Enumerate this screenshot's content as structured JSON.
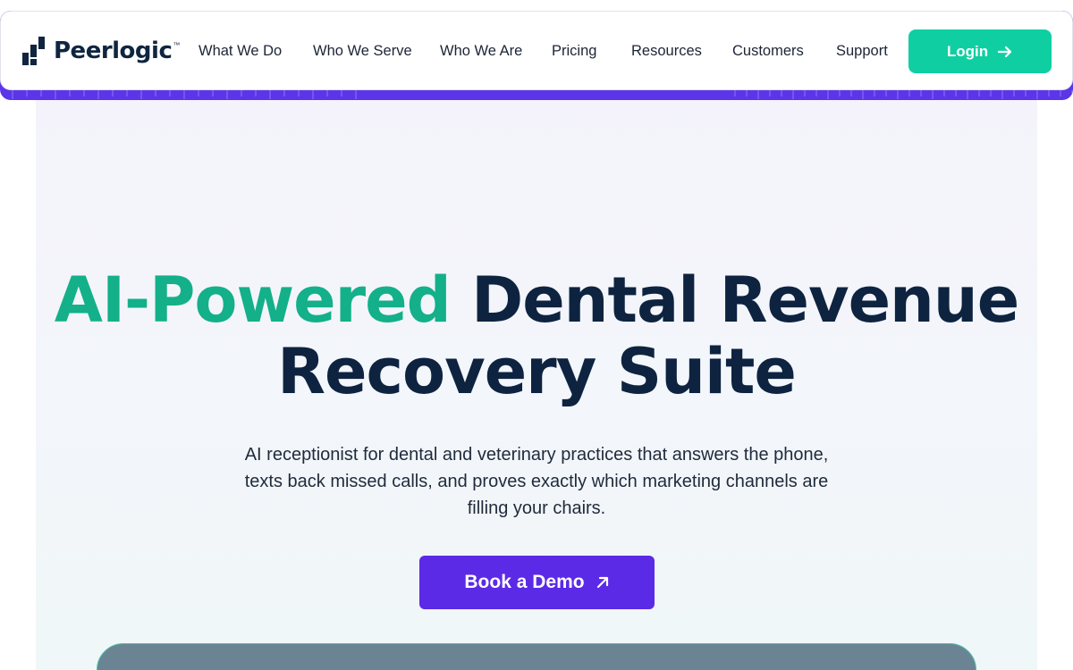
{
  "brand": {
    "name": "Peerlogic",
    "trademark": "™",
    "color_dark": "#0f2540",
    "accent_green": "#13b08a",
    "accent_purple": "#5b2ae6",
    "login_green": "#0fcfa2"
  },
  "nav": {
    "items": [
      {
        "label": "What We Do"
      },
      {
        "label": "Who We Serve"
      },
      {
        "label": "Who We Are"
      },
      {
        "label": "Pricing"
      },
      {
        "label": "Resources"
      },
      {
        "label": "Customers"
      },
      {
        "label": "Support"
      }
    ],
    "login_label": "Login",
    "login_icon": "arrow-right-icon"
  },
  "hero": {
    "headline_accent": "AI-Powered",
    "headline_rest_line1": "Dental Revenue",
    "headline_line2": "Recovery Suite",
    "subtext": "AI receptionist for dental and veterinary practices that answers the phone, texts back missed calls, and proves exactly which marketing channels are filling your chairs.",
    "cta_label": "Book a Demo",
    "cta_icon": "arrow-up-right-icon"
  }
}
